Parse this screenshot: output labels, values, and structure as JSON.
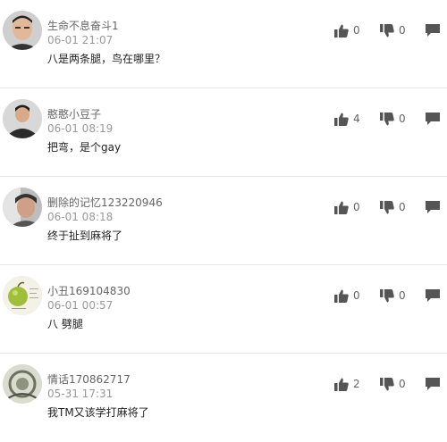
{
  "comments": [
    {
      "username": "生命不息奋斗1",
      "time": "06-01 21:07",
      "text": "八是两条腿，鸟在哪里？",
      "likes": "0",
      "dislikes": "0",
      "avatar_icon": "user-photo-icon"
    },
    {
      "username": "憨憨小豆子",
      "time": "06-01 08:19",
      "text": "把弯，是个gay",
      "likes": "4",
      "dislikes": "0",
      "avatar_icon": "user-photo-icon"
    },
    {
      "username": "删除的记忆123220946",
      "time": "06-01 08:18",
      "text": "终于扯到麻将了",
      "likes": "0",
      "dislikes": "0",
      "avatar_icon": "user-photo-icon"
    },
    {
      "username": "小丑169104830",
      "time": "06-01 00:57",
      "text": "八 劈腿",
      "likes": "0",
      "dislikes": "0",
      "avatar_icon": "user-photo-icon"
    },
    {
      "username": "情话170862717",
      "time": "05-31 17:31",
      "text": "我TM又该学打麻将了",
      "likes": "2",
      "dislikes": "0",
      "avatar_icon": "user-photo-icon"
    }
  ],
  "icons": {
    "like": "thumbs-up-icon",
    "dislike": "thumbs-down-icon",
    "reply": "comment-bubble-icon"
  },
  "colors": {
    "icon": "#555555",
    "divider": "#e6e6e6"
  }
}
